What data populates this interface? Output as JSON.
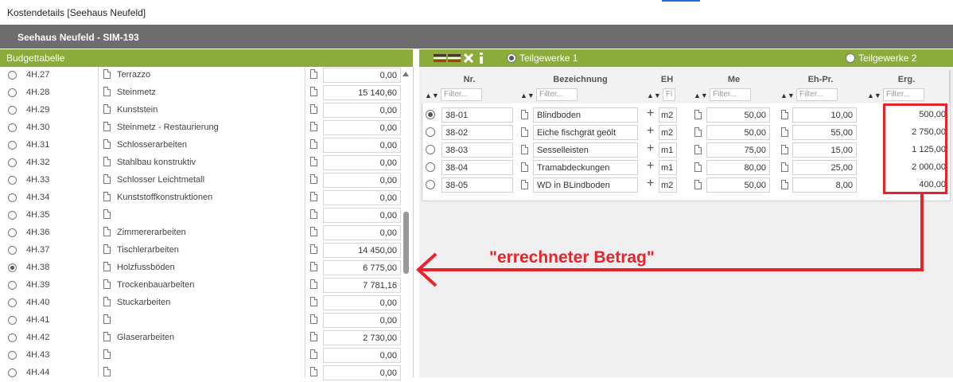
{
  "window": {
    "title": "Kostendetails [Seehaus Neufeld]"
  },
  "header": {
    "title": "Seehaus Neufeld - SIM-193"
  },
  "left": {
    "title": "Budgettabelle",
    "rows": [
      {
        "code": "4H.27",
        "name": "Terrazzo",
        "value": "0,00",
        "selected": false
      },
      {
        "code": "4H.28",
        "name": "Steinmetz",
        "value": "15 140,60",
        "selected": false
      },
      {
        "code": "4H.29",
        "name": "Kunststein",
        "value": "0,00",
        "selected": false
      },
      {
        "code": "4H.30",
        "name": "Steinmetz - Restaurierung",
        "value": "0,00",
        "selected": false
      },
      {
        "code": "4H.31",
        "name": "Schlosserarbeiten",
        "value": "0,00",
        "selected": false
      },
      {
        "code": "4H.32",
        "name": "Stahlbau konstruktiv",
        "value": "0,00",
        "selected": false
      },
      {
        "code": "4H.33",
        "name": "Schlosser Leichtmetall",
        "value": "0,00",
        "selected": false
      },
      {
        "code": "4H.34",
        "name": "Kunststoffkonstruktionen",
        "value": "0,00",
        "selected": false
      },
      {
        "code": "4H.35",
        "name": "",
        "value": "0,00",
        "selected": false
      },
      {
        "code": "4H.36",
        "name": "Zimmererarbeiten",
        "value": "0,00",
        "selected": false
      },
      {
        "code": "4H.37",
        "name": "Tischlerarbeiten",
        "value": "14 450,00",
        "selected": false
      },
      {
        "code": "4H.38",
        "name": "Holzfussböden",
        "value": "6 775,00",
        "selected": true
      },
      {
        "code": "4H.39",
        "name": "Trockenbauarbeiten",
        "value": "7 781,16",
        "selected": false
      },
      {
        "code": "4H.40",
        "name": "Stuckarbeiten",
        "value": "0,00",
        "selected": false
      },
      {
        "code": "4H.41",
        "name": "",
        "value": "0,00",
        "selected": false
      },
      {
        "code": "4H.42",
        "name": "Glaserarbeiten",
        "value": "2 730,00",
        "selected": false
      },
      {
        "code": "4H.43",
        "name": "",
        "value": "0,00",
        "selected": false
      },
      {
        "code": "4H.44",
        "name": "",
        "value": "0,00",
        "selected": false
      }
    ]
  },
  "right": {
    "toolbar": {
      "option1": "Teilgewerke 1",
      "option2": "Teilgewerke 2",
      "selected": "option1"
    },
    "columns": [
      {
        "key": "nr",
        "label": "Nr.",
        "filter": "Filter..."
      },
      {
        "key": "bez",
        "label": "Bezeichnung",
        "filter": "Filter..."
      },
      {
        "key": "eh",
        "label": "EH",
        "filter": "Fi"
      },
      {
        "key": "me",
        "label": "Me",
        "filter": "Filter..."
      },
      {
        "key": "ehpr",
        "label": "Eh-Pr.",
        "filter": "Filter..."
      },
      {
        "key": "erg",
        "label": "Erg.",
        "filter": "Filter..."
      }
    ],
    "rows": [
      {
        "nr": "38-01",
        "bez": "Blindboden",
        "eh": "m2",
        "me": "50,00",
        "ehpr": "10,00",
        "erg": "500,00",
        "selected": true
      },
      {
        "nr": "38-02",
        "bez": "Eiche fischgrät geölt",
        "eh": "m2",
        "me": "50,00",
        "ehpr": "55,00",
        "erg": "2 750,00",
        "selected": false
      },
      {
        "nr": "38-03",
        "bez": "Sesselleisten",
        "eh": "m1",
        "me": "75,00",
        "ehpr": "15,00",
        "erg": "1 125,00",
        "selected": false
      },
      {
        "nr": "38-04",
        "bez": "Tramabdeckungen",
        "eh": "m1",
        "me": "80,00",
        "ehpr": "25,00",
        "erg": "2 000,00",
        "selected": false
      },
      {
        "nr": "38-05",
        "bez": "WD in BLindboden",
        "eh": "m2",
        "me": "50,00",
        "ehpr": "8,00",
        "erg": "400,00",
        "selected": false
      }
    ]
  },
  "annotation": {
    "text": "\"errechneter Betrag\"",
    "color": "#e8232b"
  },
  "colors": {
    "green": "#8bab3a",
    "gray_header": "#6d6d6d",
    "red": "#e8232b"
  }
}
